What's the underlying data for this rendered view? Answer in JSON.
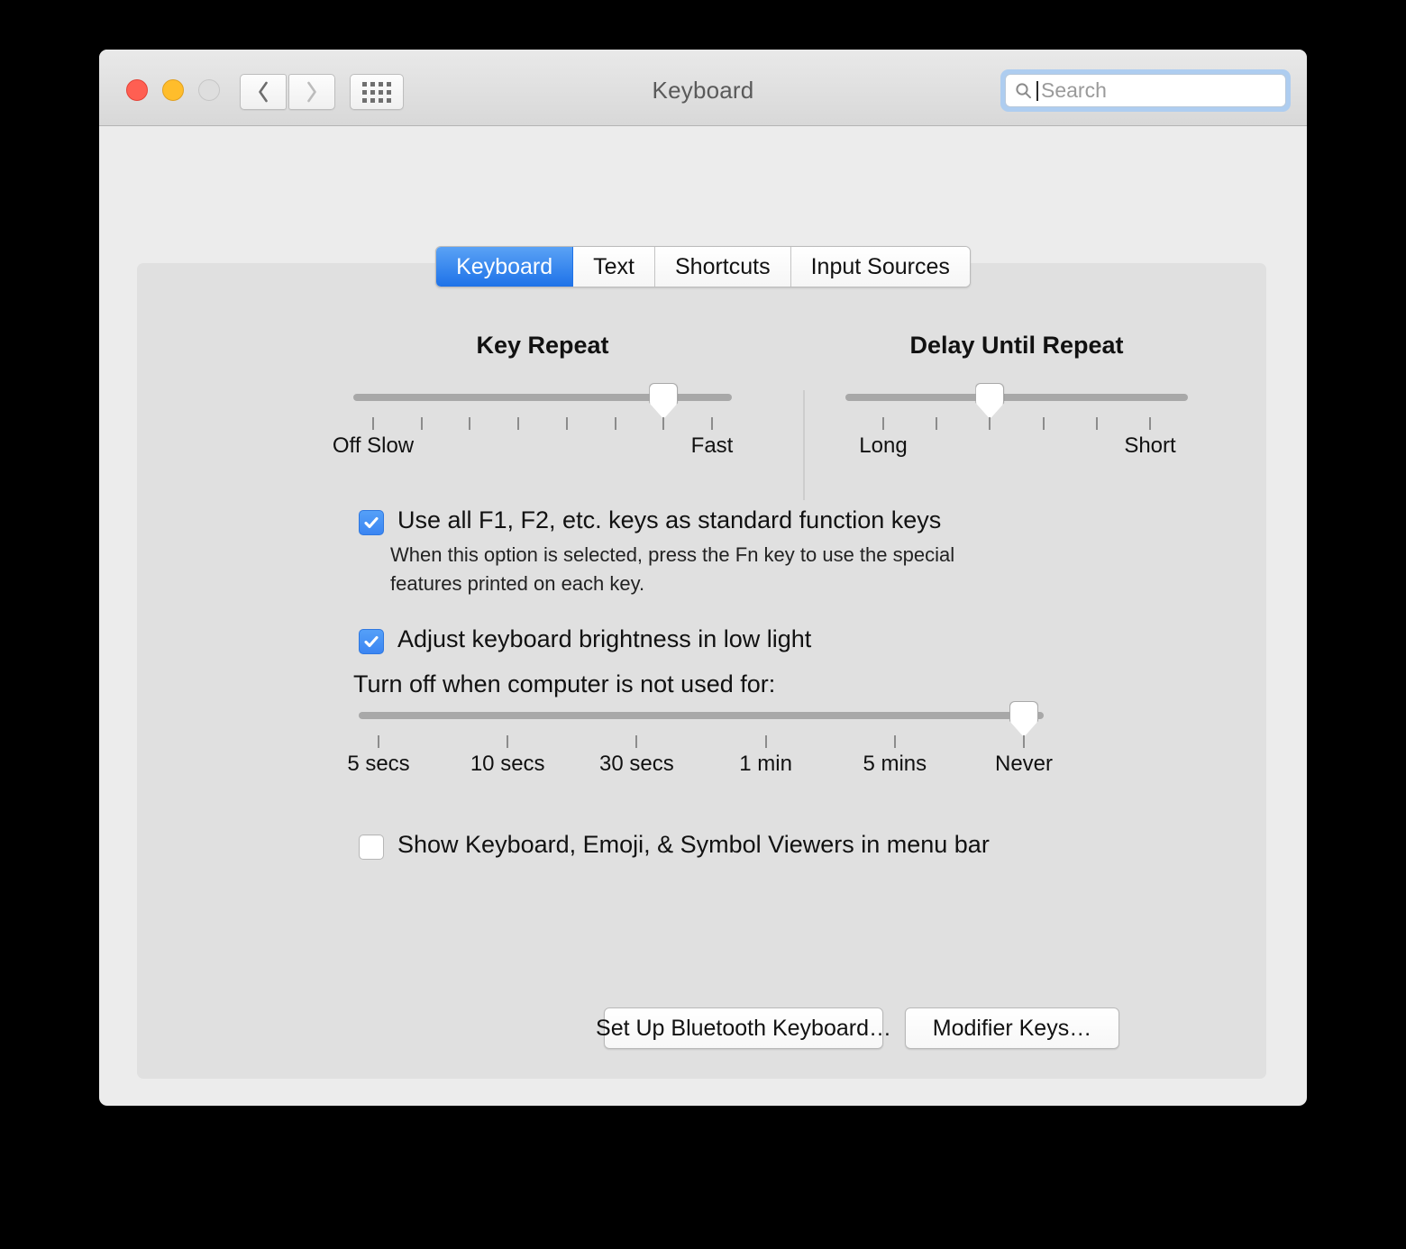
{
  "window": {
    "title": "Keyboard",
    "traffic_lights": {
      "close_color": "#ff5f52",
      "minimize_color": "#ffbd2b",
      "maximize_color": "#dedede"
    }
  },
  "toolbar": {
    "back_icon": "chevron-left-icon",
    "forward_icon": "chevron-right-icon",
    "show_all_icon": "grid-dots-icon"
  },
  "search": {
    "icon": "search-icon",
    "placeholder": "Search",
    "value": "",
    "focused": true,
    "focus_ring_color": "#aecdf0"
  },
  "tabs": [
    {
      "label": "Keyboard",
      "active": true
    },
    {
      "label": "Text",
      "active": false
    },
    {
      "label": "Shortcuts",
      "active": false
    },
    {
      "label": "Input Sources",
      "active": false
    }
  ],
  "accent_color": "#1e72e8",
  "sliders": {
    "key_repeat": {
      "title": "Key Repeat",
      "tick_count": 8,
      "value_index": 6,
      "labels": [
        {
          "text": "Off Slow",
          "index": 0
        },
        {
          "text": "Fast",
          "index": 7
        }
      ]
    },
    "delay_until_repeat": {
      "title": "Delay Until Repeat",
      "tick_count": 6,
      "value_index": 2,
      "labels": [
        {
          "text": "Long",
          "index": 0
        },
        {
          "text": "Short",
          "index": 5
        }
      ]
    },
    "backlight_timeout": {
      "tick_count": 6,
      "value_index": 5,
      "tick_labels": [
        "5 secs",
        "10 secs",
        "30 secs",
        "1 min",
        "5 mins",
        "Never"
      ]
    }
  },
  "checkboxes": {
    "fn_keys": {
      "label": "Use all F1, F2, etc. keys as standard function keys",
      "checked": true,
      "help_line1": "When this option is selected, press the Fn key to use the special",
      "help_line2": "features printed on each key."
    },
    "low_light": {
      "label": "Adjust keyboard brightness in low light",
      "checked": true
    },
    "menu_viewers": {
      "label": "Show Keyboard, Emoji, & Symbol Viewers in menu bar",
      "checked": false
    }
  },
  "labels": {
    "turn_off_after": "Turn off when computer is not used for:"
  },
  "buttons": {
    "bluetooth": "Set Up Bluetooth Keyboard…",
    "modifier_keys": "Modifier Keys…",
    "help": "?"
  }
}
